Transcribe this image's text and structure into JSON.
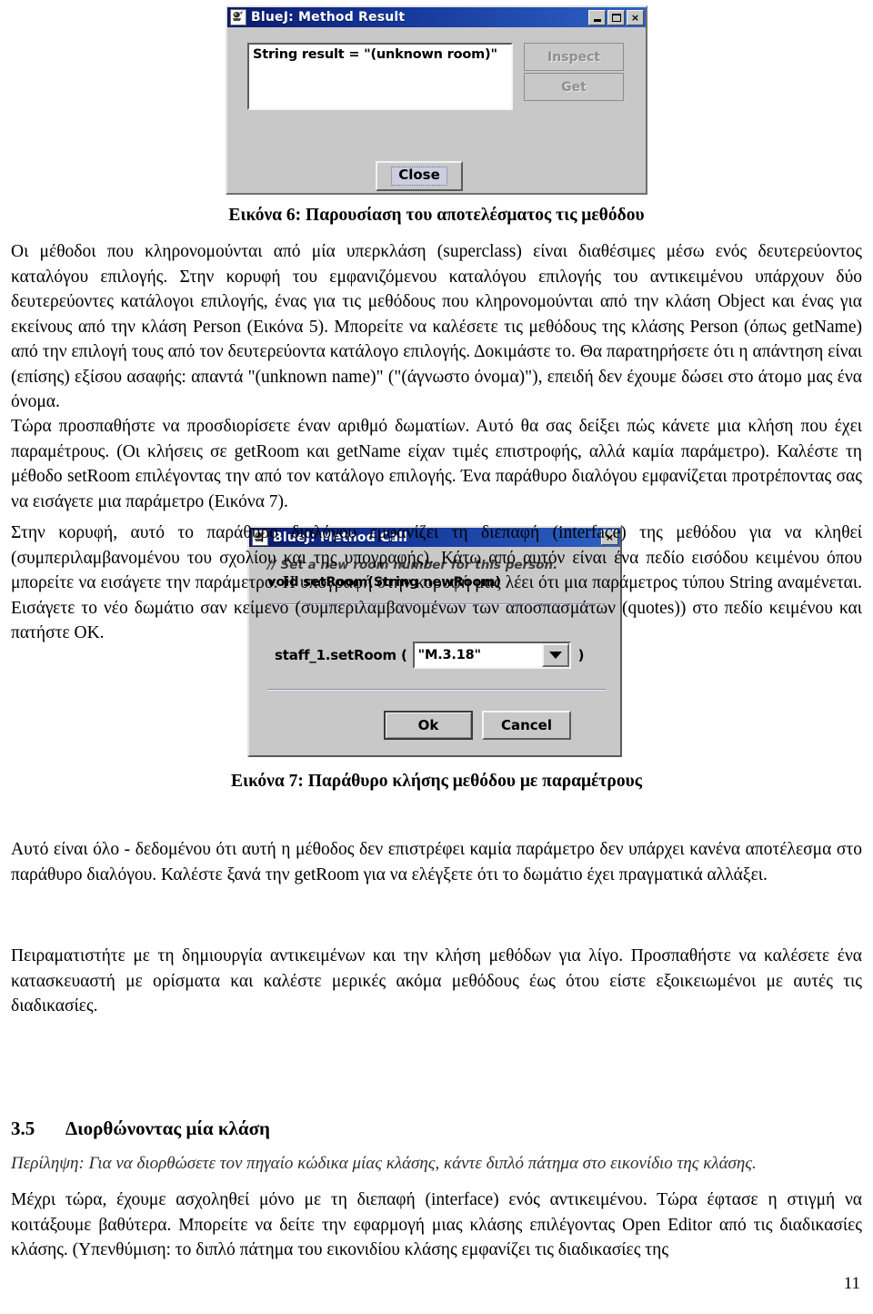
{
  "document": {
    "page_number": "11",
    "figure6": {
      "caption": "Εικόνα 6: Παρουσίαση του αποτελέσματος τις μεθόδου"
    },
    "figure7": {
      "caption": "Εικόνα 7: Παράθυρο κλήσης μεθόδου με παραμέτρους"
    },
    "paragraphs": {
      "p1": "Οι μέθοδοι που κληρονομούνται από μία υπερκλάση (superclass) είναι διαθέσιμες μέσω ενός δευτερεύοντος καταλόγου επιλογής. Στην κορυφή του εμφανιζόμενου καταλόγου επιλογής του αντικειμένου υπάρχουν δύο δευτερεύοντες κατάλογοι επιλογής, ένας για τις μεθόδους που κληρονομούνται από την κλάση Object και ένας για εκείνους από την κλάση Person (Εικόνα 5). Μπορείτε να καλέσετε τις μεθόδους της κλάσης Person (όπως getName) από την επιλογή τους από τον δευτερεύοντα κατάλογο επιλογής. Δοκιμάστε το. Θα παρατηρήσετε ότι η απάντηση είναι (επίσης) εξίσου ασαφής: απαντά \"(unknown name)\" (\"(άγνωστο όνομα)\"), επειδή δεν έχουμε δώσει στο άτομο μας ένα όνομα.",
      "p2": "Τώρα προσπαθήστε να προσδιορίσετε έναν αριθμό δωματίων. Αυτό θα σας δείξει πώς κάνετε μια κλήση που έχει παραμέτρους. (Οι κλήσεις σε getRoom και getName είχαν τιμές επιστροφής, αλλά καμία παράμετρο). Καλέστε τη μέθοδο setRoom επιλέγοντας την από τον κατάλογο επιλογής. Ένα παράθυρο διαλόγου εμφανίζεται προτρέποντας σας να εισάγετε μια παράμετρο (Εικόνα 7).",
      "p3": "Στην κορυφή, αυτό το παράθυρο διαλόγου εμφανίζει τη διεπαφή (interface) της μεθόδου για να κληθεί (συμπεριλαμβανομένου του σχολίου και της υπογραφής). Κάτω από αυτόν είναι ένα πεδίο εισόδου κειμένου όπου μπορείτε να εισάγετε την παράμετρο. Η υπογραφή στην κορυφή μας λέει ότι μια παράμετρος τύπου String αναμένεται. Εισάγετε το νέο δωμάτιο σαν κείμενο (συμπεριλαμβανομένων των αποσπασμάτων (quotes)) στο πεδίο κειμένου και πατήστε OK.",
      "p4": "Αυτό είναι όλο - δεδομένου ότι αυτή η μέθοδος δεν επιστρέφει καμία παράμετρο δεν υπάρχει κανένα αποτέλεσμα στο παράθυρο διαλόγου. Καλέστε ξανά την getRoom για να ελέγξετε ότι το δωμάτιο έχει πραγματικά αλλάξει.",
      "p5": "Πειραματιστήτε με τη δημιουργία αντικειμένων και την κλήση μεθόδων για λίγο. Προσπαθήστε να καλέσετε ένα κατασκευαστή με ορίσματα και καλέστε μερικές ακόμα μεθόδους έως ότου είστε εξοικειωμένοι με αυτές τις διαδικασίες.",
      "p6": "Μέχρι τώρα, έχουμε ασχοληθεί μόνο με τη διεπαφή (interface) ενός αντικειμένου. Τώρα έφτασε η στιγμή να κοιτάξουμε βαθύτερα. Μπορείτε να δείτε την εφαρμογή μιας κλάσης επιλέγοντας Open Editor από τις διαδικασίες κλάσης. (Υπενθύμιση: το διπλό πάτημα του εικονιδίου κλάσης εμφανίζει τις διαδικασίες της"
    },
    "section": {
      "number": "3.5",
      "title": "Διορθώνοντας μία κλάση",
      "summary": "Περίληψη: Για να διορθώσετε τον πηγαίο κώδικα μίας κλάσης, κάντε διπλό πάτημα στο εικονίδιο της κλάσης."
    }
  },
  "method_result_dialog": {
    "title": "BlueJ:  Method Result",
    "icon": "bluej-app-icon",
    "window_buttons": {
      "minimize": "minimize-icon",
      "maximize": "maximize-icon",
      "close": "×"
    },
    "result_text": "String result = \"(unknown room)\"",
    "inspect_label": "Inspect",
    "get_label": "Get",
    "close_label": "Close"
  },
  "method_call_dialog": {
    "title": "BlueJ:  Method Call",
    "icon": "bluej-app-icon",
    "close_button": "×",
    "comment": "// Set a new room number for this person.",
    "signature": "void setRoom(String newRoom)",
    "call_prefix": "staff_1.setRoom (",
    "parameter_value": "\"M.3.18\"",
    "call_suffix": ")",
    "ok_label": "Ok",
    "cancel_label": "Cancel"
  },
  "colors": {
    "title_bar_start": "#0a1a6e",
    "title_bar_end": "#2f63c4",
    "dialog_face": "#c8c8c8",
    "field_bg": "#ffffff",
    "disabled_text": "#8f8f8f"
  }
}
